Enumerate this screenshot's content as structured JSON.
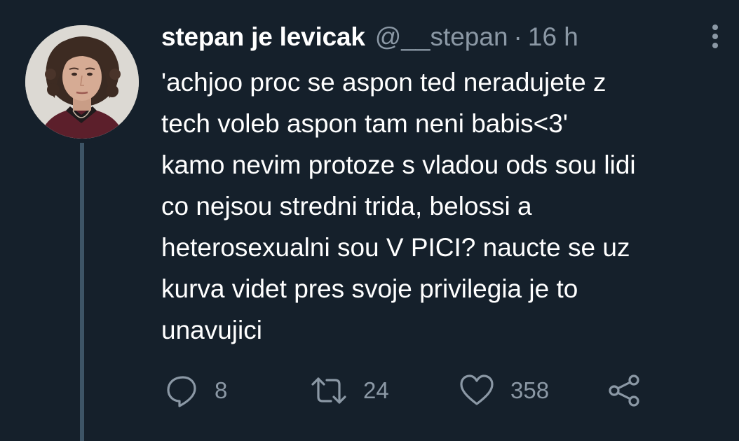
{
  "author": {
    "display_name": "stepan je levicak",
    "handle": "@__stepan",
    "separator": "·",
    "time": "16 h"
  },
  "tweet": {
    "text": "'achjoo proc se aspon ted neradujete z\ntech voleb aspon tam neni babis<3'\nkamo nevim protoze s vladou ods sou lidi\nco nejsou stredni trida, belossi a\nheterosexualni sou V PICI? naucte se uz\nkurva videt pres svoje privilegia je to\nunavujici"
  },
  "actions": {
    "reply": {
      "icon": "reply-icon",
      "count": "8"
    },
    "retweet": {
      "icon": "retweet-icon",
      "count": "24"
    },
    "like": {
      "icon": "heart-icon",
      "count": "358"
    },
    "share": {
      "icon": "share-icon"
    }
  },
  "colors": {
    "background": "#15202b",
    "primary_text": "#ffffff",
    "secondary_text": "#8b98a5",
    "thread_line": "#3d5466"
  }
}
